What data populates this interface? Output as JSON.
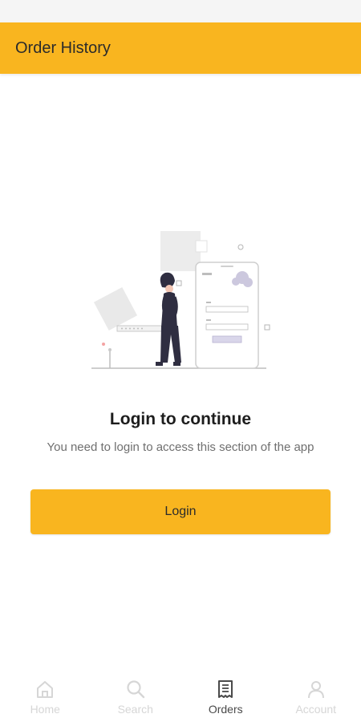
{
  "app_bar": {
    "title": "Order History"
  },
  "empty_state": {
    "title": "Login to continue",
    "message": "You need to login to access this section of the app",
    "button_label": "Login"
  },
  "bottom_nav": {
    "items": [
      {
        "label": "Home",
        "icon": "home-icon",
        "active": false
      },
      {
        "label": "Search",
        "icon": "search-icon",
        "active": false
      },
      {
        "label": "Orders",
        "icon": "orders-icon",
        "active": true
      },
      {
        "label": "Account",
        "icon": "account-icon",
        "active": false
      }
    ]
  },
  "colors": {
    "accent": "#f9b51f",
    "title_text": "#1d1d1d",
    "body_text": "#6f6f6f",
    "nav_active": "#4a4a4a",
    "nav_inactive": "#d6d6d6"
  }
}
